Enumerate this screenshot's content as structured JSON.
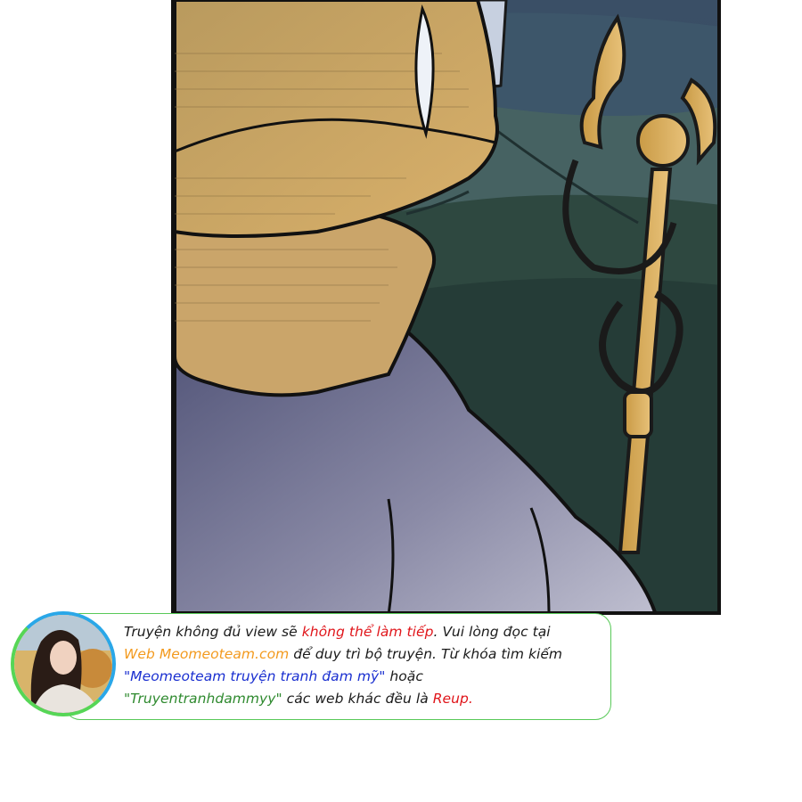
{
  "banner": {
    "line1_a": "Truyện không đủ view sẽ ",
    "line1_b": "không thể làm tiếp",
    "line1_c": ". Vui lòng đọc tại",
    "line2_a": "Web Meomeoteam.com",
    "line2_b": " để duy trì bộ truyện. Từ khóa tìm kiếm",
    "line3_a": "\"Meomeoteam truyện tranh đam mỹ\"",
    "line3_b": " hoặc",
    "line4_a": "\"Truyentranhdammyy\"",
    "line4_b": " các web khác đều là ",
    "line4_c": "Reup."
  },
  "colors": {
    "highlight_red": "#e0161b",
    "site_orange": "#f39a1e",
    "keyword_blue": "#1a2fd0",
    "keyword_green": "#2f8a2f",
    "frame_green": "#58c958",
    "ring_blue": "#2aa7e8"
  },
  "icons": {
    "avatar": "girl-portrait-avatar"
  }
}
